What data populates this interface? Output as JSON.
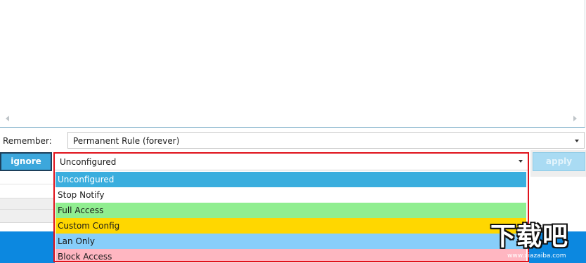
{
  "remember": {
    "label": "Remember:",
    "selected_value": "Permanent Rule (forever)"
  },
  "actions": {
    "ignore_label": "ignore",
    "apply_label": "apply",
    "apply_enabled": false
  },
  "access_combo": {
    "selected_value": "Unconfigured",
    "expanded": true,
    "options": [
      {
        "label": "Unconfigured",
        "color": "#3aaede",
        "selected": true
      },
      {
        "label": "Stop Notify",
        "color": "#ffffff",
        "selected": false
      },
      {
        "label": "Full Access",
        "color": "#90ee90",
        "selected": false
      },
      {
        "label": "Custom Config",
        "color": "#ffd700",
        "selected": false
      },
      {
        "label": "Lan Only",
        "color": "#87cefa",
        "selected": false
      },
      {
        "label": "Block Access",
        "color": "#ffb6c1",
        "selected": false
      }
    ]
  },
  "highlight_color": "#e0121b",
  "watermark": {
    "text": "下载吧",
    "url": "www.xiazaiba.com"
  }
}
